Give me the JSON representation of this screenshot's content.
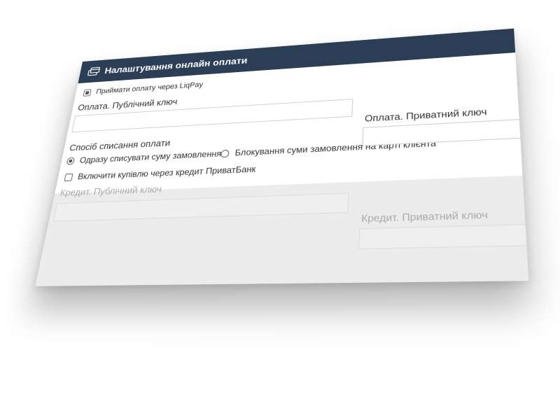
{
  "header": {
    "title": "Налаштування онлайн оплати",
    "icon": "credit-card-icon"
  },
  "liqpay": {
    "checkbox_label": "Приймати оплату через LiqPay",
    "checked": true
  },
  "public_key": {
    "label": "Оплата. Публічний ключ",
    "value": ""
  },
  "private_key": {
    "label": "Оплата. Приватний ключ",
    "value": ""
  },
  "charge_method": {
    "label": "Спосіб списання оплати",
    "options": [
      {
        "label": "Одразу списувати суму замовлення",
        "selected": true
      },
      {
        "label": "Блокування суми замовлення на карті клієнта",
        "selected": false
      }
    ]
  },
  "credit": {
    "checkbox_label": "Включити купівлю через кредит ПриватБанк",
    "checked": false,
    "public_key_label": "Кредит. Публічний ключ",
    "private_key_label": "Кредит. Приватний ключ"
  },
  "colors": {
    "header_bg": "#2b3e55",
    "disabled_bg": "#ececec"
  }
}
